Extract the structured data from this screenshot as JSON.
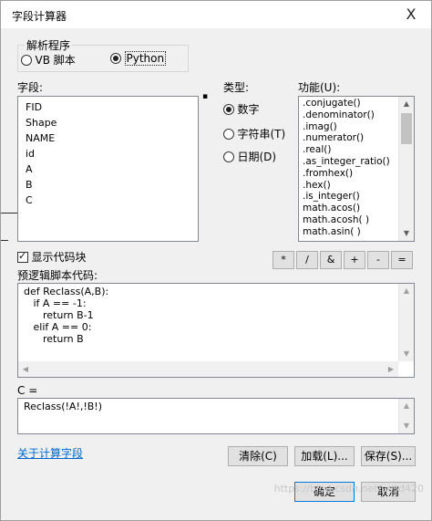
{
  "window": {
    "title": "字段计算器",
    "close_glyph": "X"
  },
  "parser": {
    "label": "解析程序",
    "options": [
      {
        "label": "VB 脚本",
        "selected": false
      },
      {
        "label": "Python",
        "selected": true
      }
    ]
  },
  "fields": {
    "label": "字段:",
    "items": [
      "FID",
      "Shape",
      "NAME",
      "id",
      "A",
      "B",
      "C"
    ]
  },
  "types": {
    "label": "类型:",
    "options": [
      {
        "label": "数字",
        "selected": true
      },
      {
        "label": "字符串(T)",
        "selected": false
      },
      {
        "label": "日期(D)",
        "selected": false
      }
    ]
  },
  "functions": {
    "label": "功能(U):",
    "items": [
      ".conjugate()",
      ".denominator()",
      ".imag()",
      ".numerator()",
      ".real()",
      ".as_integer_ratio()",
      ".fromhex()",
      ".hex()",
      ".is_integer()",
      "math.acos()",
      "math.acosh( )",
      "math.asin( )"
    ]
  },
  "operators": [
    "*",
    "/",
    "&",
    "+",
    "-",
    "="
  ],
  "show_codeblock": {
    "label": "显示代码块",
    "checked": true
  },
  "prelogic": {
    "label": "预逻辑脚本代码:",
    "lines": [
      "def Reclass(A,B):",
      "   if A == -1:",
      "      return B-1",
      "   elif A == 0:",
      "      return B"
    ]
  },
  "expression": {
    "label": "C =",
    "value": "Reclass(!A!,!B!)"
  },
  "about_link": "关于计算字段",
  "buttons": {
    "clear": "清除(C)",
    "load": "加载(L)...",
    "save": "保存(S)...",
    "ok": "确定",
    "cancel": "取消"
  },
  "watermark": "https://blog.csdn.net/ucsd420"
}
